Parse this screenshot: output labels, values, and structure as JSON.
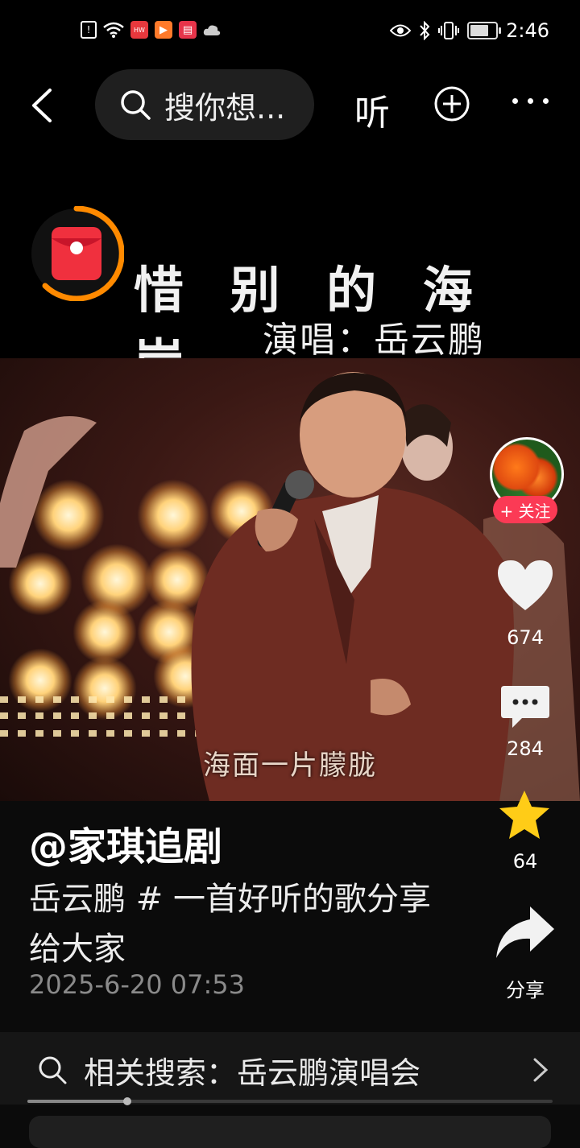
{
  "status_bar": {
    "time": "2:46",
    "battery_level": 0.8,
    "icons": [
      "alert-icon",
      "wifi-icon",
      "huawei-app-icon",
      "video-app-icon",
      "reader-app-icon",
      "cloud-icon",
      "eye-icon",
      "bluetooth-icon",
      "vibrate-icon",
      "battery-icon"
    ]
  },
  "header": {
    "search_placeholder": "搜你想...",
    "listen_label": "听"
  },
  "video_overlay": {
    "title": "惜 别 的 海 岸",
    "singer": "演唱：岳云鹏",
    "subtitle": "海面一片朦胧"
  },
  "rail": {
    "follow_label": "+ 关注",
    "likes": "674",
    "comments": "284",
    "favorites": "64",
    "share_label": "分享"
  },
  "post": {
    "author": "@家琪追剧",
    "description": "岳云鹏 # 一首好听的歌分享给大家",
    "date": "2025-6-20 07:53"
  },
  "related": {
    "text": "相关搜索：岳云鹏演唱会"
  },
  "progress": {
    "fraction": 0.19
  },
  "colors": {
    "accent": "#fb3a55",
    "star": "#ffcc17",
    "ring": "#ff8a00"
  }
}
